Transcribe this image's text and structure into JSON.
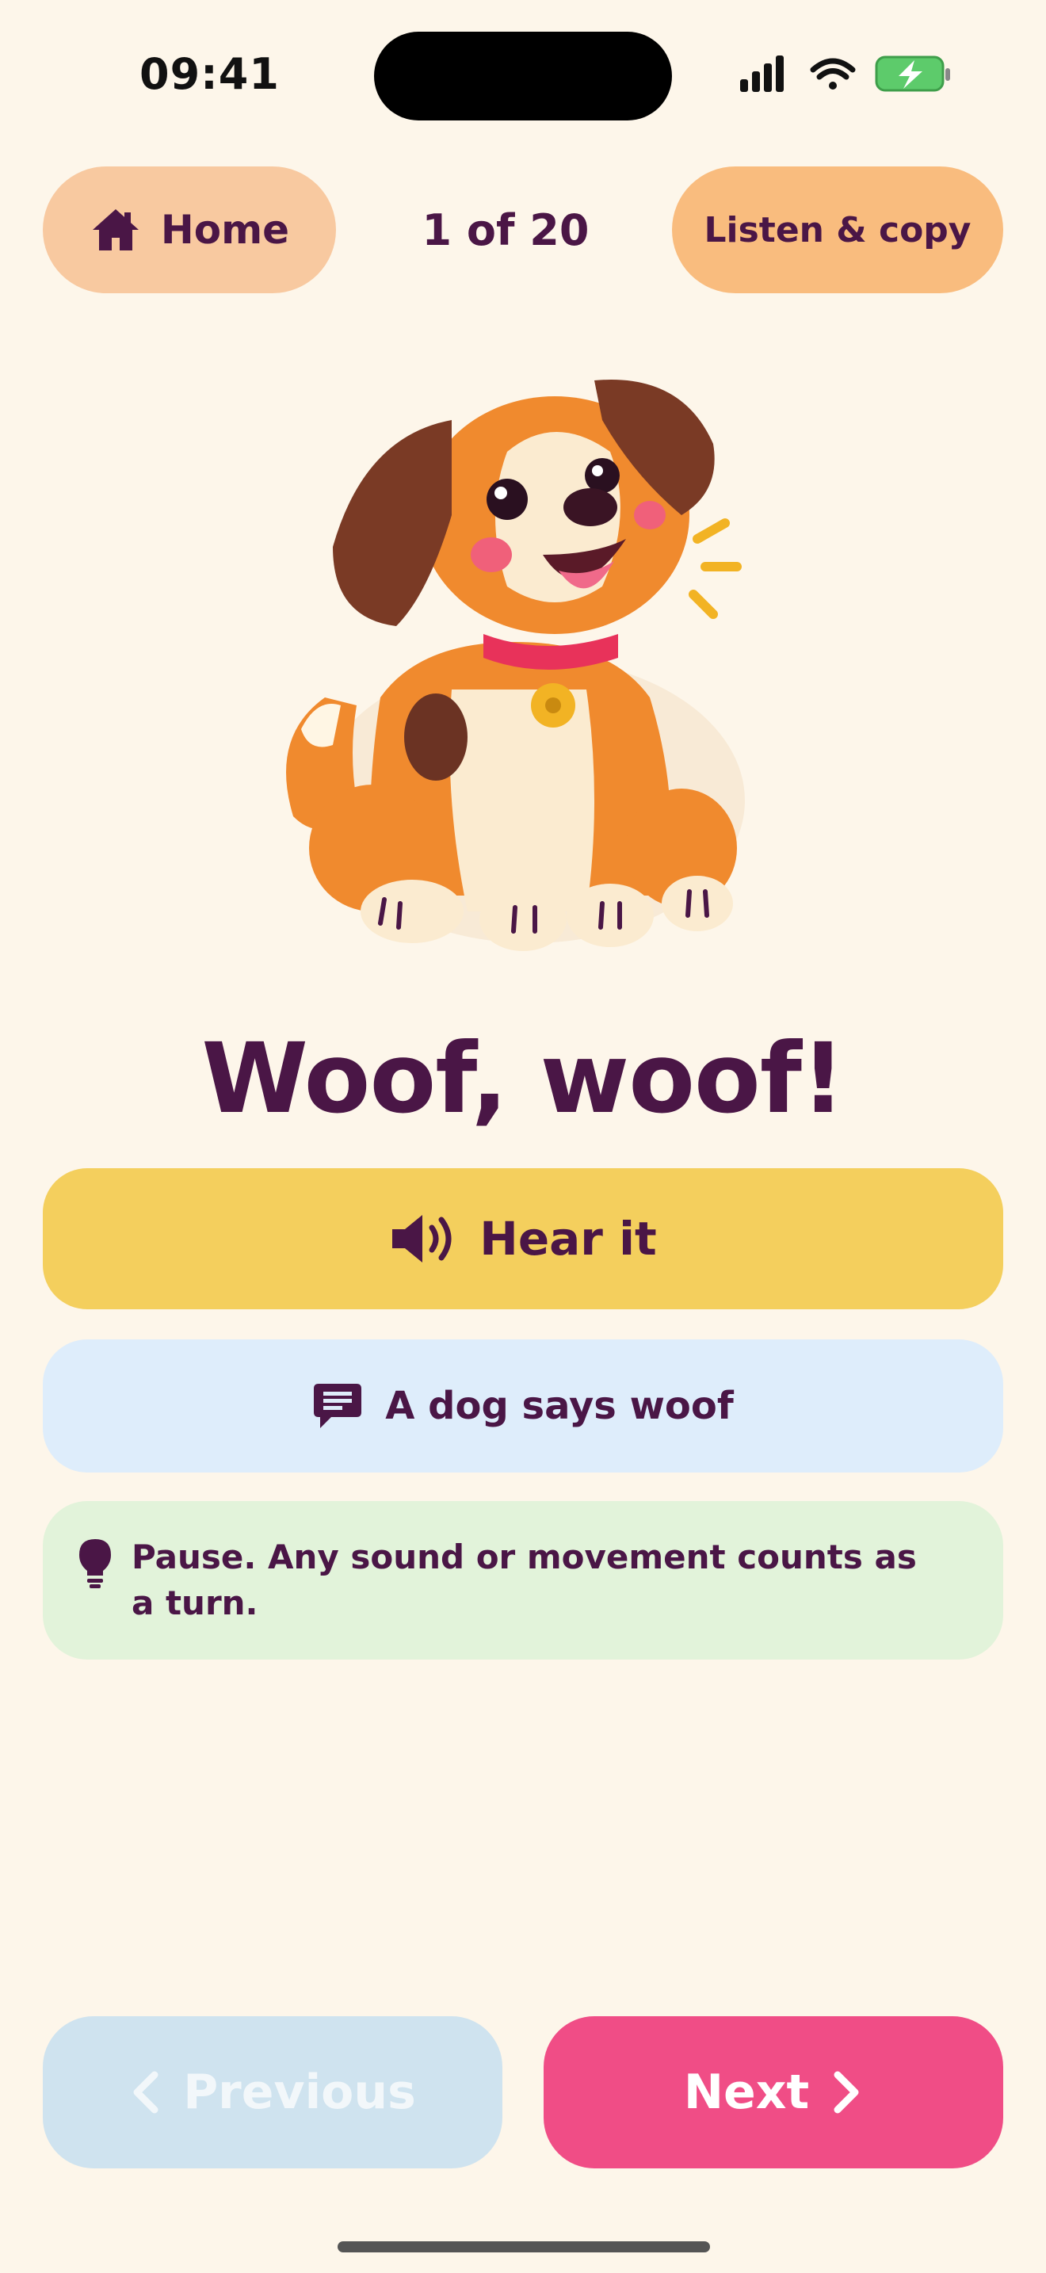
{
  "status_bar": {
    "time": "09:41"
  },
  "header": {
    "home_label": "Home",
    "progress": "1 of 20",
    "listen_label": "Listen & copy"
  },
  "card": {
    "title": "Woof, woof!",
    "hear_label": "Hear it",
    "caption": "A dog says woof",
    "tip": "Pause. Any sound or movement counts as a turn."
  },
  "nav": {
    "previous_label": "Previous",
    "next_label": "Next"
  },
  "icons": {
    "home": "house-icon",
    "hear": "speaker-icon",
    "caption": "chat-bubble-icon",
    "tip": "lightbulb-icon",
    "previous": "chevron-left-icon",
    "next": "chevron-right-icon"
  },
  "colors": {
    "background": "#FDF6EA",
    "text": "#4A1646",
    "home_button": "#F8C9A0",
    "listen_button": "#F9BC7E",
    "hear_button": "#F4CF5D",
    "caption_card": "#DEEDFB",
    "tip_card": "#E2F3DA",
    "next_button": "#F04D86",
    "previous_button": "#CFE3EF"
  }
}
